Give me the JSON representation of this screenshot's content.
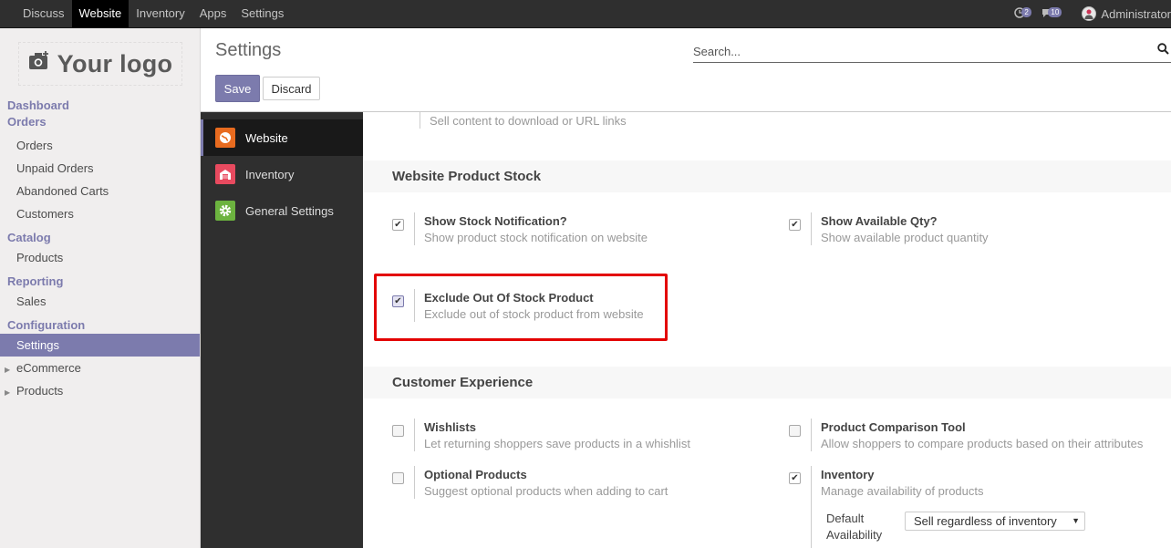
{
  "topbar": {
    "menu": [
      "Discuss",
      "Website",
      "Inventory",
      "Apps",
      "Settings"
    ],
    "active_menu": "Website",
    "activity_count": "2",
    "messages_count": "10",
    "user": "Administrator"
  },
  "sidebar": {
    "logo_text": "Your logo",
    "groups": [
      {
        "head": "Dashboard",
        "items": []
      },
      {
        "head": "Orders",
        "items": [
          "Orders",
          "Unpaid Orders",
          "Abandoned Carts",
          "Customers"
        ]
      },
      {
        "head": "Catalog",
        "items": [
          "Products"
        ]
      },
      {
        "head": "Reporting",
        "items": [
          "Sales"
        ]
      },
      {
        "head": "Configuration",
        "items": [
          "Settings"
        ]
      }
    ],
    "active_item": "Settings",
    "collapsed": [
      "eCommerce",
      "Products"
    ]
  },
  "control_panel": {
    "title": "Settings",
    "search_placeholder": "Search...",
    "save_label": "Save",
    "discard_label": "Discard"
  },
  "apps": [
    {
      "label": "Website",
      "icon": "website-icon",
      "color": "#e86b1f",
      "active": true
    },
    {
      "label": "Inventory",
      "icon": "inventory-icon",
      "color": "#e84a5f",
      "active": false
    },
    {
      "label": "General Settings",
      "icon": "gear-icon",
      "color": "#6cb33f",
      "active": false
    }
  ],
  "main": {
    "top_partial_desc": "Sell content to download or URL links",
    "stock_section": {
      "title": "Website Product Stock",
      "settings": [
        {
          "label": "Show Stock Notification?",
          "desc": "Show product stock notification on website",
          "checked": true
        },
        {
          "label": "Show Available Qty?",
          "desc": "Show available product quantity",
          "checked": true
        },
        {
          "label": "Exclude Out Of Stock Product",
          "desc": "Exclude out of stock product from website",
          "checked": true
        }
      ]
    },
    "customer_section": {
      "title": "Customer Experience",
      "settings": [
        {
          "label": "Wishlists",
          "desc": "Let returning shoppers save products in a whishlist",
          "checked": false
        },
        {
          "label": "Product Comparison Tool",
          "desc": "Allow shoppers to compare products based on their attributes",
          "checked": false
        },
        {
          "label": "Optional Products",
          "desc": "Suggest optional products when adding to cart",
          "checked": false
        },
        {
          "label": "Inventory",
          "desc": "Manage availability of products",
          "checked": true
        }
      ]
    },
    "default_availability_label_1": "Default",
    "default_availability_label_2": "Availability",
    "default_availability_value": "Sell regardless of inventory"
  }
}
